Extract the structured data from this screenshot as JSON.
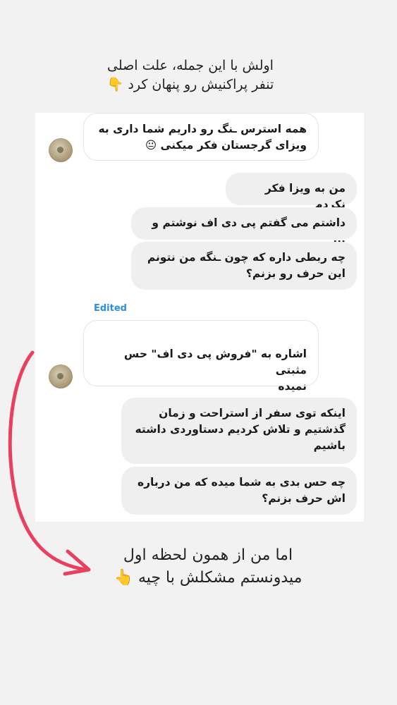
{
  "story": {
    "top_caption_line1": "اولش با این جمله، علت اصلی",
    "top_caption_line2": "تنفر پراکنیش رو پنهان کرد 👇",
    "bottom_caption_line1": "اما من از همون لحظه اول",
    "bottom_caption_line2": "میدونستم مشکلش با چیه 👆"
  },
  "chat": {
    "edited_label": "Edited",
    "messages": [
      {
        "side": "incoming",
        "line1": "همه استرس  ـنگ رو داریم شما داری به",
        "line2": "ویزای گرجستان فکر میکنی 😐"
      },
      {
        "side": "outgoing",
        "line1": "من به ویزا فکر نکردم"
      },
      {
        "side": "outgoing",
        "line1": "داشتم می گفتم پی دی اف نوشتم و ..."
      },
      {
        "side": "outgoing",
        "line1": "چه ربطی داره که چون ـنگه من نتونم",
        "line2": "این حرف رو بزنم؟"
      },
      {
        "side": "incoming",
        "line1": "اشاره به \"فروش پی دی اف\" حس مثبتی",
        "line2": "نمیده"
      },
      {
        "side": "outgoing",
        "line1": "اینکه توی سفر از استراحت و زمان",
        "line2": "گذشتیم و تلاش کردیم دستاوردی داشته",
        "line3": "باشیم"
      },
      {
        "side": "outgoing",
        "line1": "چه حس بدی به شما میده که من درباره",
        "line2": "اش حرف بزنم؟"
      }
    ]
  },
  "colors": {
    "page_background": "#f2f2f2",
    "chat_background": "#ffffff",
    "outgoing_bubble": "#efefef",
    "edited_label": "#2b8fe0",
    "arrow": "#e8405e"
  }
}
